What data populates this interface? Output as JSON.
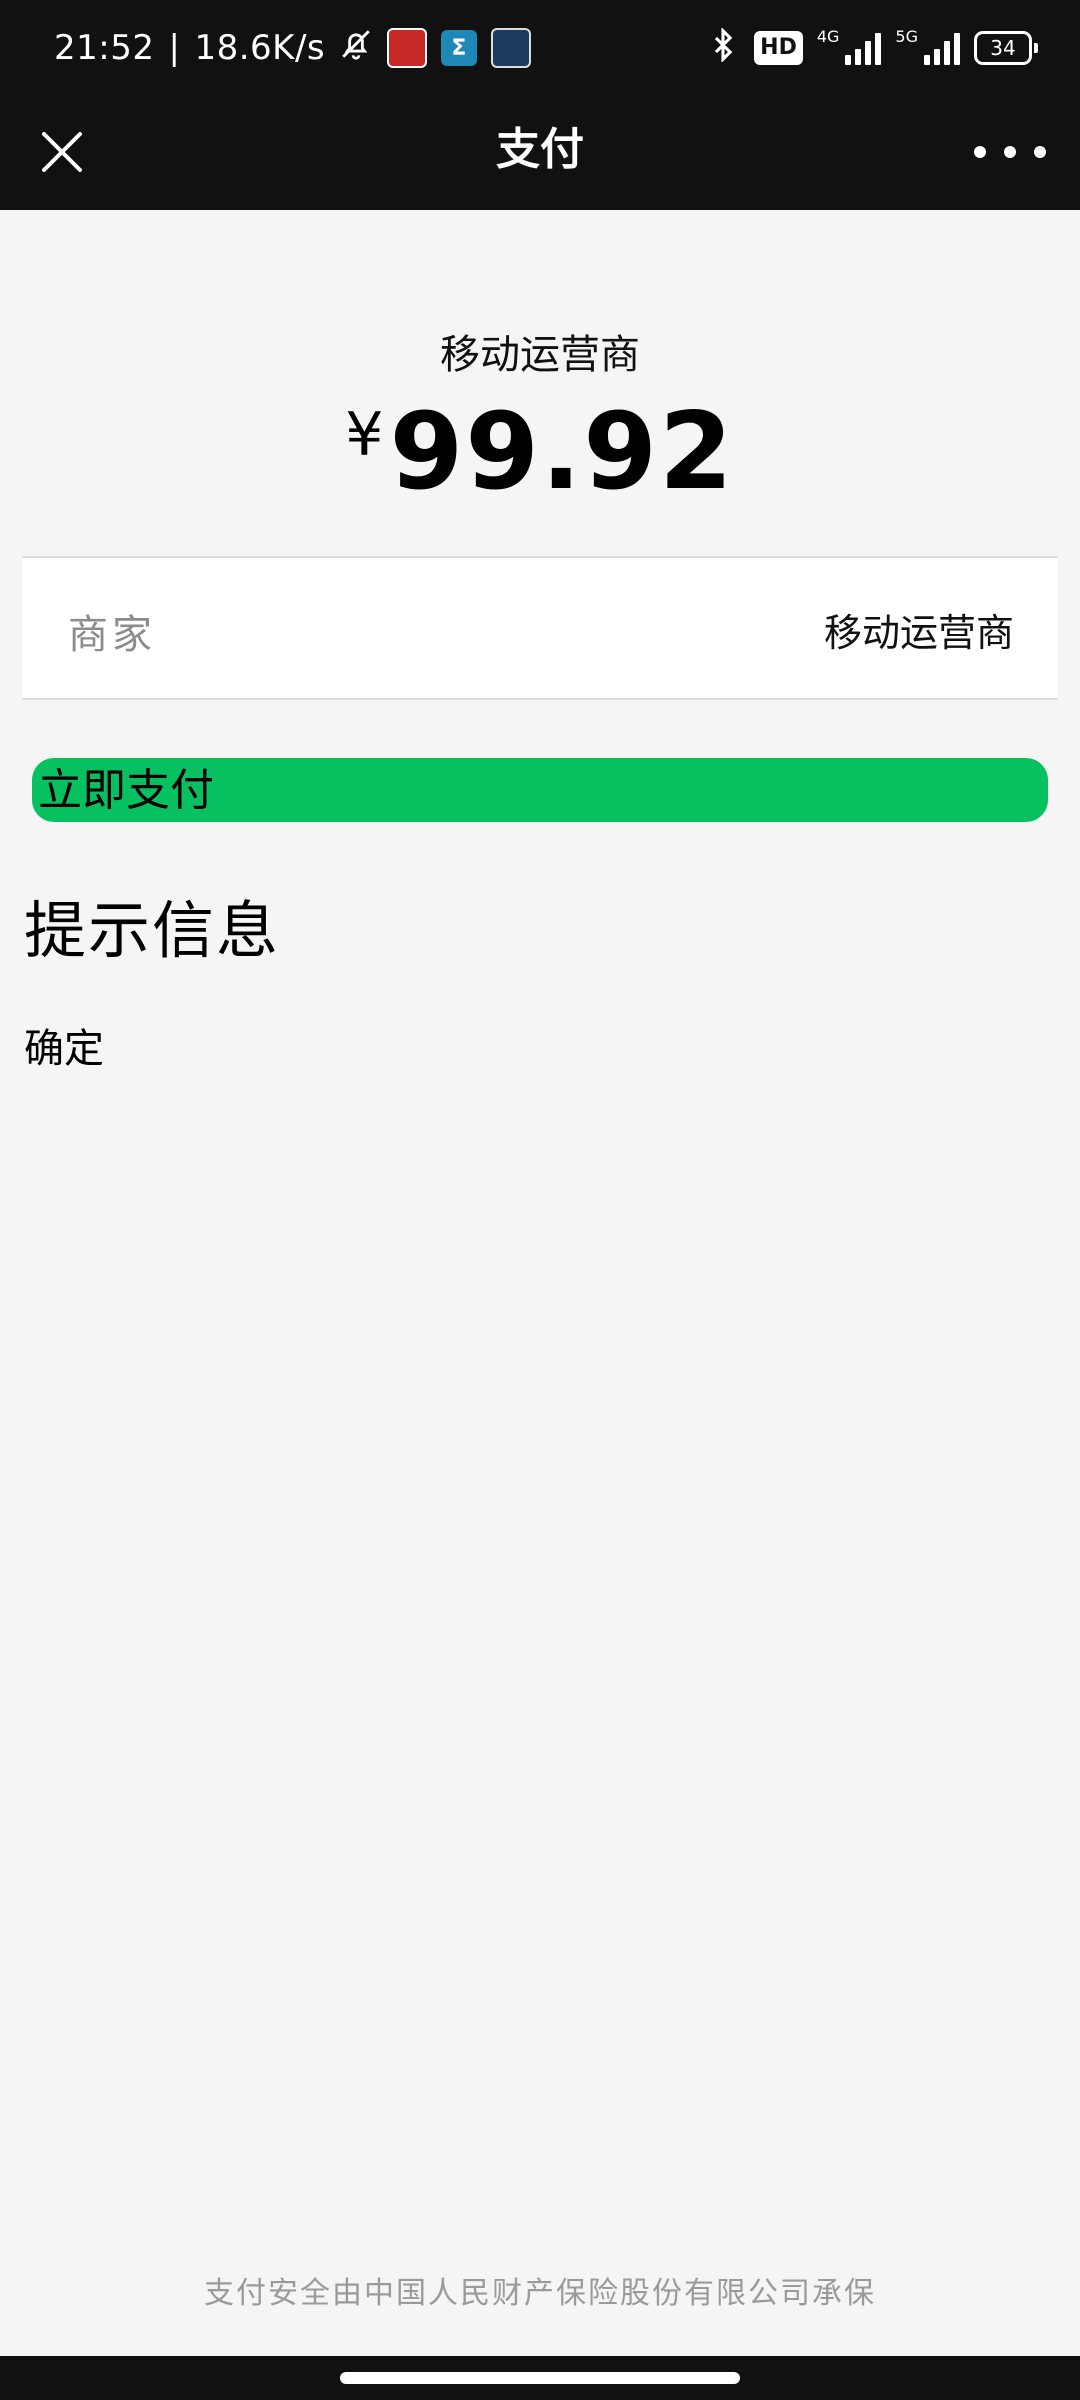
{
  "status_bar": {
    "time": "21:52",
    "separator": "|",
    "net_speed": "18.6K/s",
    "hd_label": "HD",
    "sim1_label": "4G",
    "sim2_label": "5G",
    "battery": "34"
  },
  "nav": {
    "title": "支付"
  },
  "payment": {
    "merchant_title": "移动运营商",
    "currency_symbol": "¥",
    "amount": "99.92"
  },
  "info_row": {
    "label": "商家",
    "value": "移动运营商"
  },
  "actions": {
    "pay_label": "立即支付"
  },
  "tips": {
    "heading": "提示信息",
    "confirm_label": "确定"
  },
  "footer": {
    "note": "支付安全由中国人民财产保险股份有限公司承保"
  },
  "colors": {
    "accent_green": "#07c160",
    "header_bg": "#111111",
    "page_bg": "#f5f5f5"
  },
  "icons": {
    "close": "close-icon",
    "more": "more-icon",
    "mute": "bell-off-icon",
    "bluetooth": "bluetooth-icon"
  }
}
